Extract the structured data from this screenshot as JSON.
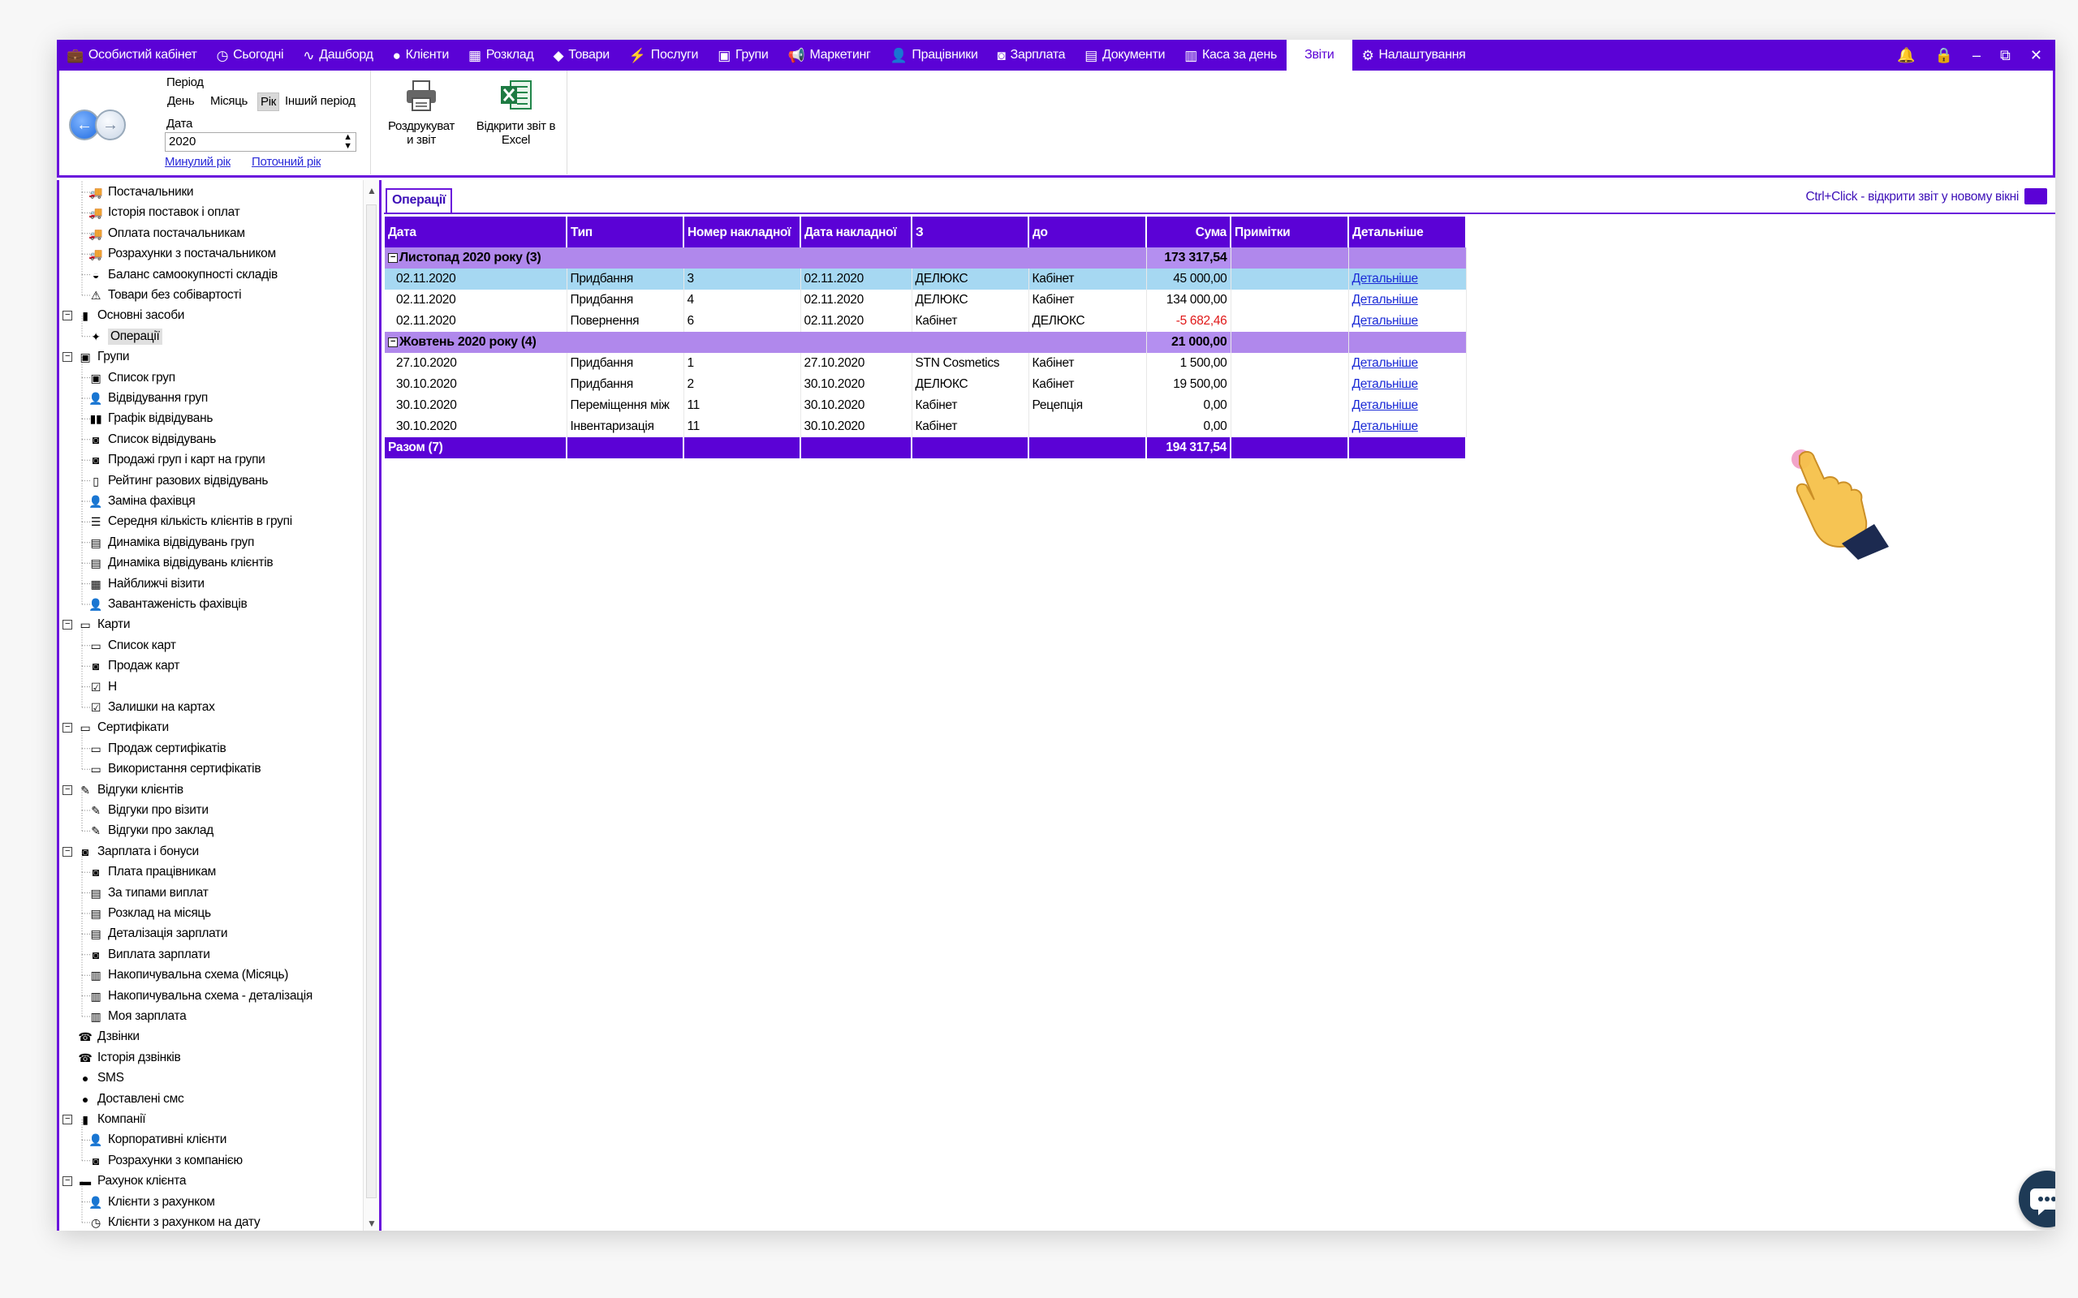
{
  "menubar": {
    "items": [
      {
        "label": "Особистий кабінет",
        "icon": "briefcase-icon",
        "glyph": "💼"
      },
      {
        "label": "Сьогодні",
        "icon": "clock-icon",
        "glyph": "◷"
      },
      {
        "label": "Дашборд",
        "icon": "pulse-icon",
        "glyph": "∿"
      },
      {
        "label": "Клієнти",
        "icon": "user-circle-icon",
        "glyph": "●"
      },
      {
        "label": "Розклад",
        "icon": "calendar-icon",
        "glyph": "▦"
      },
      {
        "label": "Товари",
        "icon": "box-icon",
        "glyph": "◆"
      },
      {
        "label": "Послуги",
        "icon": "bolt-icon",
        "glyph": "⚡"
      },
      {
        "label": "Групи",
        "icon": "group-icon",
        "glyph": "▣"
      },
      {
        "label": "Маркетинг",
        "icon": "megaphone-icon",
        "glyph": "📢"
      },
      {
        "label": "Працівники",
        "icon": "person-icon",
        "glyph": "👤"
      },
      {
        "label": "Зарплата",
        "icon": "money-icon",
        "glyph": "◙"
      },
      {
        "label": "Документи",
        "icon": "document-icon",
        "glyph": "▤"
      },
      {
        "label": "Каса за день",
        "icon": "calculator-icon",
        "glyph": "▥"
      },
      {
        "label": "Звіти",
        "icon": "",
        "glyph": "",
        "active": true
      },
      {
        "label": "Налаштування",
        "icon": "gear-icon",
        "glyph": "⚙"
      }
    ],
    "controls": {
      "bell": "🔔",
      "lock": "🔒",
      "minimize": "–",
      "restore": "⧉",
      "close": "✕"
    }
  },
  "ribbon": {
    "period_label": "Період",
    "period_buttons": [
      "День",
      "Місяць",
      "Рік",
      "Інший період"
    ],
    "selected_period": "Рік",
    "date_label": "Дата",
    "year_value": "2020",
    "link_prev": "Минулий рік",
    "link_current": "Поточний рік",
    "print_label_1": "Роздрукуват",
    "print_label_2": "и звіт",
    "excel_label_1": "Відкрити звіт в",
    "excel_label_2": "Excel"
  },
  "tree": {
    "items": [
      {
        "label": "Постачальники",
        "level": 2,
        "icon": "truck-icon",
        "glyph": "🚚"
      },
      {
        "label": "Історія поставок і оплат",
        "level": 2,
        "icon": "truck-icon",
        "glyph": "🚚"
      },
      {
        "label": "Оплата постачальникам",
        "level": 2,
        "icon": "truck-icon",
        "glyph": "🚚"
      },
      {
        "label": "Розрахунки з постачальником",
        "level": 2,
        "icon": "truck-icon",
        "glyph": "🚚"
      },
      {
        "label": "Баланс самоокупності складів",
        "level": 2,
        "icon": "scale-icon",
        "glyph": "◒"
      },
      {
        "label": "Товари без собівартості",
        "level": 2,
        "icon": "warning-icon",
        "glyph": "⚠"
      },
      {
        "label": "Основні засоби",
        "level": 1,
        "icon": "building-icon",
        "glyph": "▮",
        "expander": "−"
      },
      {
        "label": "Операції",
        "level": 2,
        "icon": "operations-icon",
        "glyph": "✦",
        "selected": true
      },
      {
        "label": "Групи",
        "level": 1,
        "icon": "group-icon",
        "glyph": "▣",
        "expander": "−"
      },
      {
        "label": "Список груп",
        "level": 2,
        "icon": "group-icon",
        "glyph": "▣"
      },
      {
        "label": "Відвідування груп",
        "level": 2,
        "icon": "person-icon",
        "glyph": "👤"
      },
      {
        "label": "Графік відвідувань",
        "level": 2,
        "icon": "bar-chart-icon",
        "glyph": "▮▮"
      },
      {
        "label": "Список відвідувань",
        "level": 2,
        "icon": "money-icon",
        "glyph": "◙"
      },
      {
        "label": "Продажі груп і карт на групи",
        "level": 2,
        "icon": "money-icon",
        "glyph": "◙"
      },
      {
        "label": "Рейтинг разових відвідувань",
        "level": 2,
        "icon": "rating-icon",
        "glyph": "▯"
      },
      {
        "label": "Заміна фахівця",
        "level": 2,
        "icon": "person-icon",
        "glyph": "👤"
      },
      {
        "label": "Середня кількість клієнтів в групі",
        "level": 2,
        "icon": "list-icon",
        "glyph": "☰"
      },
      {
        "label": "Динаміка відвідувань груп",
        "level": 2,
        "icon": "table-icon",
        "glyph": "▤"
      },
      {
        "label": "Динаміка відвідувань клієнтів",
        "level": 2,
        "icon": "table-icon",
        "glyph": "▤"
      },
      {
        "label": "Найближчі візити",
        "level": 2,
        "icon": "calendar-icon",
        "glyph": "▦"
      },
      {
        "label": "Завантаженість фахівців",
        "level": 2,
        "icon": "person-icon",
        "glyph": "👤"
      },
      {
        "label": "Карти",
        "level": 1,
        "icon": "card-icon",
        "glyph": "▭",
        "expander": "−"
      },
      {
        "label": "Список карт",
        "level": 2,
        "icon": "card-icon",
        "glyph": "▭"
      },
      {
        "label": "Продаж карт",
        "level": 2,
        "icon": "money-icon",
        "glyph": "◙"
      },
      {
        "label": "Н",
        "level": 2,
        "icon": "check-card-icon",
        "glyph": "☑"
      },
      {
        "label": "Залишки на картах",
        "level": 2,
        "icon": "check-card-icon",
        "glyph": "☑"
      },
      {
        "label": "Сертифікати",
        "level": 1,
        "icon": "certificate-icon",
        "glyph": "▭",
        "expander": "−"
      },
      {
        "label": "Продаж сертифікатів",
        "level": 2,
        "icon": "certificate-icon",
        "glyph": "▭"
      },
      {
        "label": "Використання сертифікатів",
        "level": 2,
        "icon": "certificate-icon",
        "glyph": "▭"
      },
      {
        "label": "Відгуки клієнтів",
        "level": 1,
        "icon": "feedback-icon",
        "glyph": "✎",
        "expander": "−"
      },
      {
        "label": "Відгуки про візити",
        "level": 2,
        "icon": "feedback-icon",
        "glyph": "✎"
      },
      {
        "label": "Відгуки про заклад",
        "level": 2,
        "icon": "feedback-icon",
        "glyph": "✎"
      },
      {
        "label": "Зарплата і бонуси",
        "level": 1,
        "icon": "money-icon",
        "glyph": "◙",
        "expander": "−"
      },
      {
        "label": "Плата працівникам",
        "level": 2,
        "icon": "money-icon",
        "glyph": "◙"
      },
      {
        "label": "За типами виплат",
        "level": 2,
        "icon": "table-icon",
        "glyph": "▤"
      },
      {
        "label": "Розклад на місяць",
        "level": 2,
        "icon": "table-icon",
        "glyph": "▤"
      },
      {
        "label": "Деталізація зарплати",
        "level": 2,
        "icon": "table-icon",
        "glyph": "▤"
      },
      {
        "label": "Виплата зарплати",
        "level": 2,
        "icon": "money-icon",
        "glyph": "◙"
      },
      {
        "label": "Накопичувальна схема (Місяць)",
        "level": 2,
        "icon": "calculator-icon",
        "glyph": "▥"
      },
      {
        "label": "Накопичувальна схема - деталізація",
        "level": 2,
        "icon": "calculator-icon",
        "glyph": "▥"
      },
      {
        "label": "Моя зарплата",
        "level": 2,
        "icon": "calculator-icon",
        "glyph": "▥"
      },
      {
        "label": "Дзвінки",
        "level": 1,
        "icon": "phone-icon",
        "glyph": "☎"
      },
      {
        "label": "Історія дзвінків",
        "level": 1,
        "icon": "phone-icon",
        "glyph": "☎"
      },
      {
        "label": "SMS",
        "level": 1,
        "icon": "chat-bubble-icon",
        "glyph": "●"
      },
      {
        "label": "Доставлені смс",
        "level": 1,
        "icon": "chat-bubble-icon",
        "glyph": "●"
      },
      {
        "label": "Компанії",
        "level": 1,
        "icon": "company-icon",
        "glyph": "▮",
        "expander": "−"
      },
      {
        "label": "Корпоративні клієнти",
        "level": 2,
        "icon": "person-icon",
        "glyph": "👤"
      },
      {
        "label": "Розрахунки з компанією",
        "level": 2,
        "icon": "money-icon",
        "glyph": "◙"
      },
      {
        "label": "Рахунок клієнта",
        "level": 1,
        "icon": "wallet-icon",
        "glyph": "▬",
        "expander": "−"
      },
      {
        "label": "Клієнти з рахунком",
        "level": 2,
        "icon": "person-icon",
        "glyph": "👤"
      },
      {
        "label": "Клієнти з рахунком на дату",
        "level": 2,
        "icon": "history-icon",
        "glyph": "◷"
      }
    ]
  },
  "content": {
    "tab_label": "Операції",
    "hint": "Ctrl+Click - відкрити звіт у новому вікні",
    "columns": [
      "Дата",
      "Тип",
      "Номер накладної",
      "Дата накладної",
      "З",
      "до",
      "Сума",
      "Примітки",
      "Детальніше"
    ],
    "groups": [
      {
        "title": "Листопад 2020 року (3)",
        "sum": "173 317,54",
        "rows": [
          {
            "date": "02.11.2020",
            "type": "Придбання",
            "num": "3",
            "inv_date": "02.11.2020",
            "from": "ДЕЛЮКС",
            "to": "Кабінет",
            "sum": "45 000,00",
            "note": "",
            "link": "Детальніше",
            "highlight": true
          },
          {
            "date": "02.11.2020",
            "type": "Придбання",
            "num": "4",
            "inv_date": "02.11.2020",
            "from": "ДЕЛЮКС",
            "to": "Кабінет",
            "sum": "134 000,00",
            "note": "",
            "link": "Детальніше"
          },
          {
            "date": "02.11.2020",
            "type": "Повернення",
            "num": "6",
            "inv_date": "02.11.2020",
            "from": "Кабінет",
            "to": "ДЕЛЮКС",
            "sum": "-5 682,46",
            "note": "",
            "link": "Детальніше",
            "negative": true
          }
        ]
      },
      {
        "title": "Жовтень 2020 року (4)",
        "sum": "21 000,00",
        "rows": [
          {
            "date": "27.10.2020",
            "type": "Придбання",
            "num": "1",
            "inv_date": "27.10.2020",
            "from": "STN Cosmetics",
            "to": "Кабінет",
            "sum": "1 500,00",
            "note": "",
            "link": "Детальніше"
          },
          {
            "date": "30.10.2020",
            "type": "Придбання",
            "num": "2",
            "inv_date": "30.10.2020",
            "from": "ДЕЛЮКС",
            "to": "Кабінет",
            "sum": "19 500,00",
            "note": "",
            "link": "Детальніше"
          },
          {
            "date": "30.10.2020",
            "type": "Переміщення між",
            "num": "11",
            "inv_date": "30.10.2020",
            "from": "Кабінет",
            "to": "Рецепція",
            "sum": "0,00",
            "note": "",
            "link": "Детальніше"
          },
          {
            "date": "30.10.2020",
            "type": "Інвентаризація",
            "num": "11",
            "inv_date": "30.10.2020",
            "from": "Кабінет",
            "to": "",
            "sum": "0,00",
            "note": "",
            "link": "Детальніше"
          }
        ]
      }
    ],
    "total_label": "Разом (7)",
    "total_sum": "194 317,54"
  },
  "colors": {
    "brand": "#5b02d6",
    "group_row": "#b088ec",
    "highlight_row": "#a6d8f2",
    "negative": "#e01818"
  }
}
